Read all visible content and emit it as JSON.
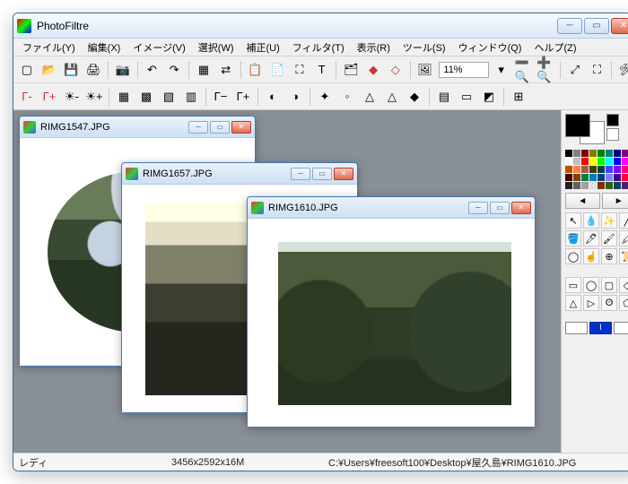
{
  "app": {
    "title": "PhotoFiltre"
  },
  "menu": [
    "ファイル(Y)",
    "編集(X)",
    "イメージ(V)",
    "選択(W)",
    "補正(U)",
    "フィルタ(T)",
    "表示(R)",
    "ツール(S)",
    "ウィンドウ(Q)",
    "ヘルプ(Z)"
  ],
  "toolbar": {
    "zoom": "11%"
  },
  "docs": [
    {
      "title": "RIMG1547.JPG"
    },
    {
      "title": "RIMG1657.JPG"
    },
    {
      "title": "RIMG1610.JPG"
    }
  ],
  "status": {
    "left": "レディ",
    "dim": "3456x2592x16M",
    "path": "C:¥Users¥freesoft100¥Desktop¥屋久島¥RIMG1610.JPG"
  },
  "palette_colors": [
    "#000000",
    "#808080",
    "#800000",
    "#808000",
    "#008000",
    "#008080",
    "#000080",
    "#800080",
    "#7a8a40",
    "#ffffff",
    "#c0c0c0",
    "#ff0000",
    "#ffff00",
    "#00ff00",
    "#00ffff",
    "#0000ff",
    "#ff00ff",
    "#ffff80",
    "#c05000",
    "#ff8040",
    "#a06040",
    "#404000",
    "#004040",
    "#4040ff",
    "#8000ff",
    "#ff0080",
    "#ff8080",
    "#400000",
    "#804000",
    "#008040",
    "#0080c0",
    "#004080",
    "#8080ff",
    "#400080",
    "#ff0040",
    "#ff80c0",
    "#202020",
    "#606060",
    "#a0a0a0",
    "#e0e0e0",
    "#803000",
    "#306010",
    "#104060",
    "#502070",
    "#90a050"
  ],
  "swatch": {
    "fg": "#000000",
    "bg": "#ffffff"
  },
  "bottom_colors": [
    "#ffffff",
    "#0030cc",
    "#ffffff"
  ]
}
